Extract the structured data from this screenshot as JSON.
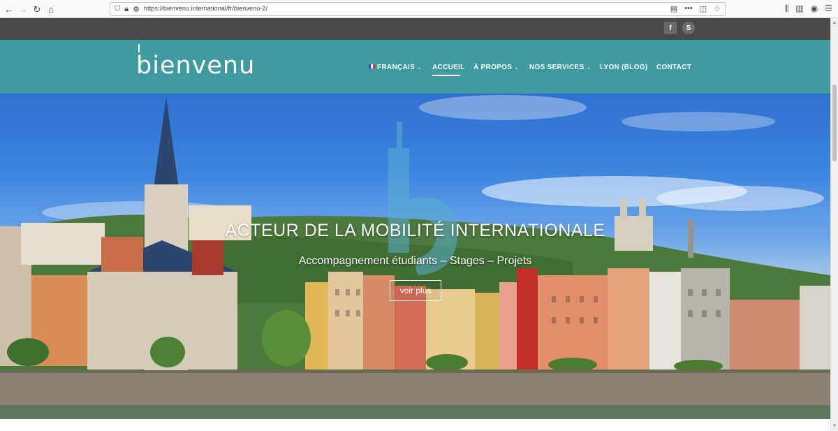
{
  "browser": {
    "back_icon": "arrow-left-icon",
    "forward_icon": "arrow-right-icon",
    "reload_icon": "reload-icon",
    "home_icon": "home-icon",
    "url": "https://bienvenu.international/fr/bienvenu-2/",
    "menu_dots": "•••"
  },
  "social": {
    "facebook": "f",
    "skype": "S"
  },
  "header": {
    "logo": "bienvenu",
    "menu": [
      {
        "label": "FRANÇAIS",
        "has_dropdown": true,
        "flag": "fr"
      },
      {
        "label": "ACCUEIL",
        "active": true
      },
      {
        "label": "À PROPOS",
        "has_dropdown": true
      },
      {
        "label": "NOS SERVICES",
        "has_dropdown": true
      },
      {
        "label": "LYON (BLOG)"
      },
      {
        "label": "CONTACT"
      }
    ]
  },
  "hero": {
    "title": "ACTEUR DE LA MOBILITÉ INTERNATIONALE",
    "subtitle": "Accompagnement étudiants – Stages – Projets",
    "button": "voir plus"
  },
  "colors": {
    "header_bg": "#3f9ba0",
    "topbar_bg": "#4a4a4a",
    "accent": "#3f9ba0"
  }
}
